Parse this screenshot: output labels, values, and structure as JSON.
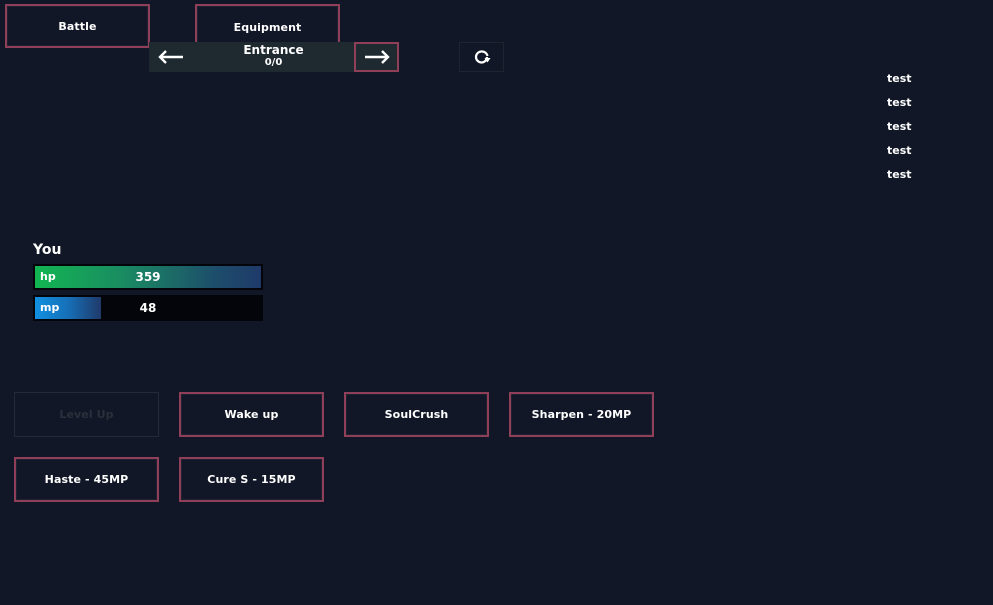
{
  "nav": {
    "battle_label": "Battle",
    "equipment_label": "Equipment"
  },
  "location": {
    "name": "Entrance",
    "progress": "0/0"
  },
  "log": [
    "test",
    "test",
    "test",
    "test",
    "test"
  ],
  "player": {
    "name": "You",
    "hp_label": "hp",
    "hp_value": "359",
    "hp_fill": 1.0,
    "mp_label": "mp",
    "mp_value": "48",
    "mp_fill": 0.29
  },
  "skills": {
    "level_up": "Level Up",
    "wake_up": "Wake up",
    "soulcrush": "SoulCrush",
    "sharpen": "Sharpen - 20MP",
    "haste": "Haste - 45MP",
    "cure_s": "Cure S - 15MP"
  },
  "colors": {
    "background": "#111726",
    "button_border": "#8f3f57",
    "hp_start": "#12b552",
    "mp_start": "#1190e0"
  },
  "icons": {
    "prev": "arrow-left-icon",
    "next": "arrow-right-icon",
    "refresh": "refresh-icon"
  }
}
